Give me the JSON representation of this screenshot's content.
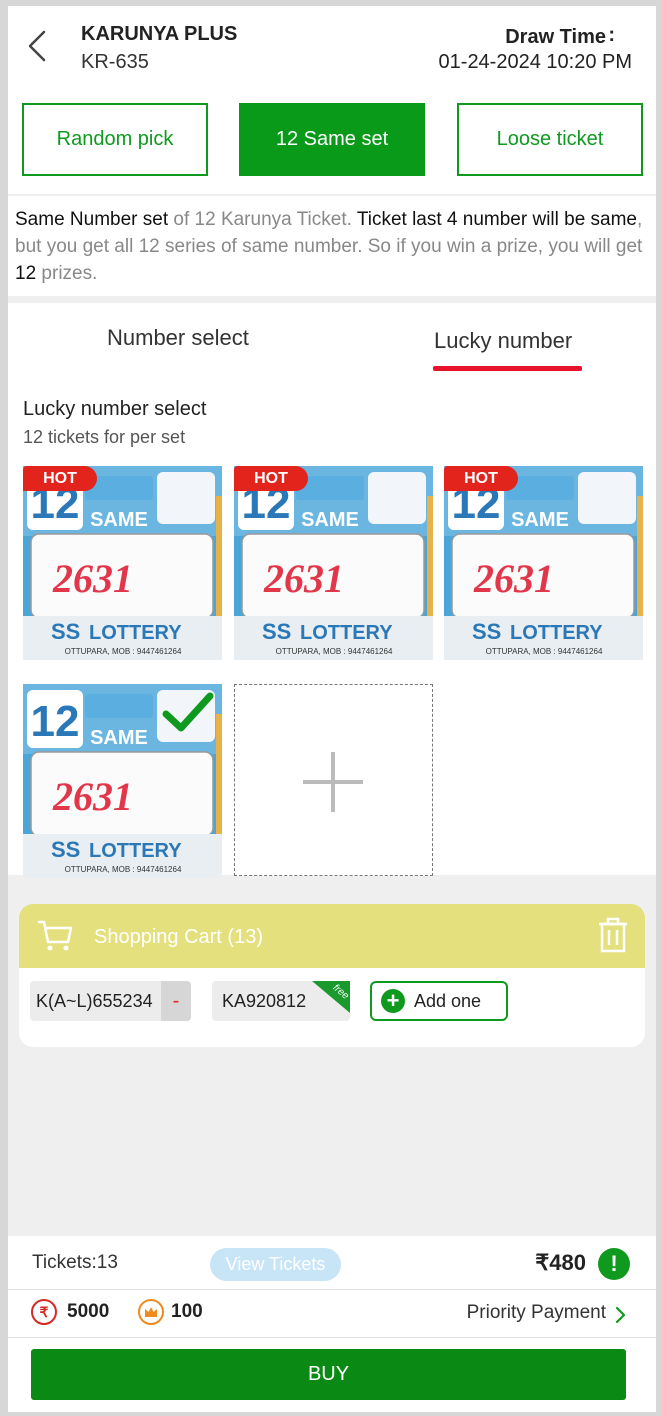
{
  "header": {
    "game_name": "KARUNYA PLUS",
    "game_code": "KR-635",
    "draw_label": "Draw Time",
    "draw_colon": ":",
    "draw_time": "01-24-2024 10:20 PM"
  },
  "modes": [
    {
      "label": "Random pick",
      "active": false
    },
    {
      "label": "12 Same set",
      "active": true
    },
    {
      "label": "Loose ticket",
      "active": false
    }
  ],
  "description": {
    "p1": "Same Number set",
    "p2": " of 12 Karunya Ticket. ",
    "p3": "Ticket last 4 number will be same",
    "p4": ", but you get all 12 series of same number. So if you win a prize, you will get ",
    "p5": "12",
    "p6": " prizes."
  },
  "tabs": [
    {
      "label": "Number select",
      "active": false
    },
    {
      "label": "Lucky number",
      "active": true
    }
  ],
  "lucky": {
    "title": "Lucky number select",
    "subtitle": "12 tickets for per set",
    "hot_label": "HOT",
    "tickets": [
      {
        "count": "12",
        "same": "SAME",
        "number": "2631",
        "brand_ss": "SS",
        "brand_lottery": "LOTTERY",
        "contact": "OTTUPARA, MOB : 9447461264",
        "hot": true,
        "selected": false
      },
      {
        "count": "12",
        "same": "SAME",
        "number": "2631",
        "brand_ss": "SS",
        "brand_lottery": "LOTTERY",
        "contact": "OTTUPARA, MOB : 9447461264",
        "hot": true,
        "selected": false
      },
      {
        "count": "12",
        "same": "SAME",
        "number": "2631",
        "brand_ss": "SS",
        "brand_lottery": "LOTTERY",
        "contact": "OTTUPARA, MOB : 9447461264",
        "hot": true,
        "selected": false
      },
      {
        "count": "12",
        "same": "SAME",
        "number": "2631",
        "brand_ss": "SS",
        "brand_lottery": "LOTTERY",
        "contact": "OTTUPARA, MOB : 9447461264",
        "hot": false,
        "selected": true
      }
    ]
  },
  "cart": {
    "title": "Shopping Cart (13)",
    "items": [
      {
        "code": "K(A~L)655234",
        "remove_label": "-"
      },
      {
        "code": "KA920812",
        "tag": "free"
      }
    ],
    "add_label": "Add one"
  },
  "bottom": {
    "tickets_label": "Tickets:13",
    "view_tickets": "View Tickets",
    "price": "₹480",
    "info_symbol": "!",
    "rupee_symbol": "₹",
    "coins": "5000",
    "points": "100",
    "priority": "Priority Payment",
    "buy": "BUY"
  },
  "colors": {
    "primary_green": "#0a9a1a",
    "accent_red": "#e8122a",
    "cart_header": "#e4e07e",
    "view_tickets_bg": "#c8e4f7"
  }
}
